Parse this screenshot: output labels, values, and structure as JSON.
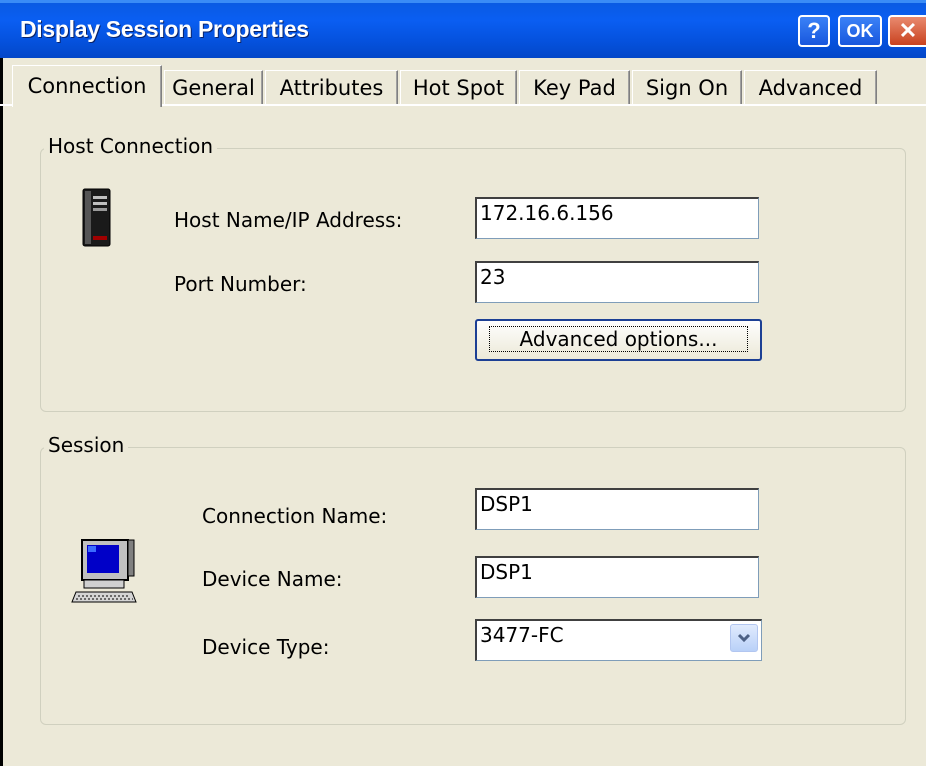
{
  "window": {
    "title": "Display Session Properties"
  },
  "titlebar_buttons": {
    "help": "?",
    "ok": "OK",
    "close": "✕"
  },
  "tabs": [
    {
      "label": "Connection",
      "active": true
    },
    {
      "label": "General"
    },
    {
      "label": "Attributes"
    },
    {
      "label": "Hot Spot"
    },
    {
      "label": "Key Pad"
    },
    {
      "label": "Sign On"
    },
    {
      "label": "Advanced"
    }
  ],
  "host_connection": {
    "legend": "Host Connection",
    "icon": "server-icon",
    "host_label": "Host Name/IP Address:",
    "host_value": "172.16.6.156",
    "port_label": "Port Number:",
    "port_value": "23",
    "advanced_button": "Advanced options..."
  },
  "session": {
    "legend": "Session",
    "icon": "computer-terminal-icon",
    "connection_name_label": "Connection Name:",
    "connection_name_value": "DSP1",
    "device_name_label": "Device Name:",
    "device_name_value": "DSP1",
    "device_type_label": "Device Type:",
    "device_type_value": "3477-FC"
  },
  "colors": {
    "titlebar": "#0a5ae0",
    "face": "#ece9d8",
    "close": "#c9421f"
  }
}
